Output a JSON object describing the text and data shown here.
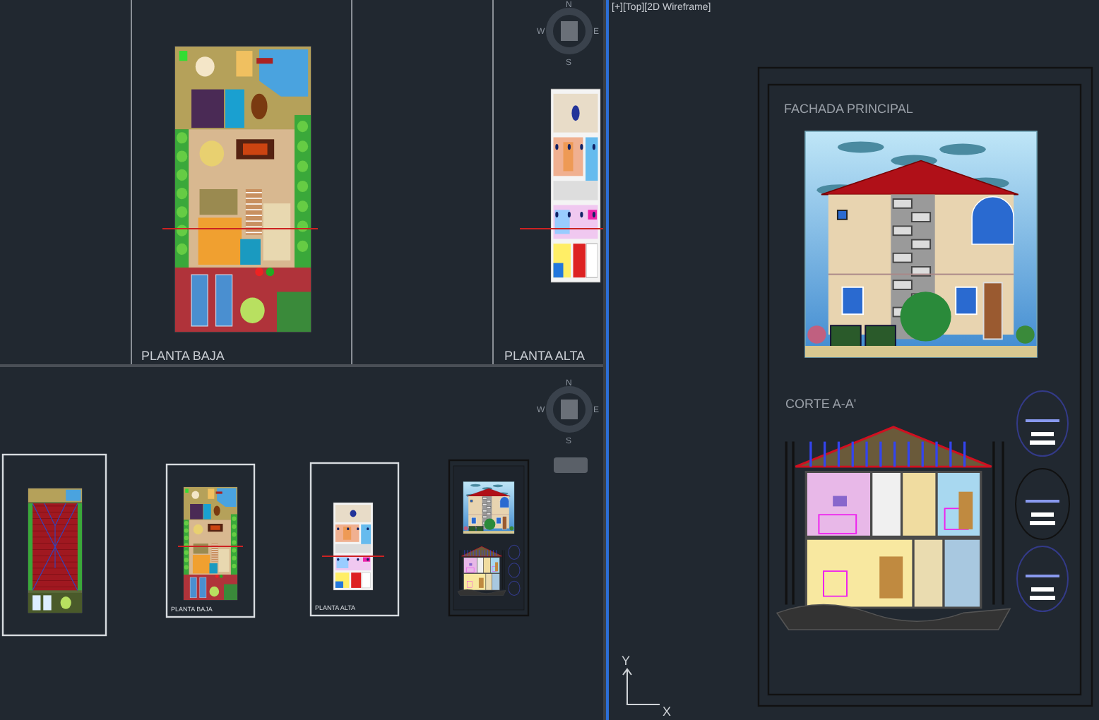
{
  "viewports": [
    {
      "kind": "plans",
      "active": false,
      "labels": [
        "PLANTA BAJA",
        "PLANTA ALTA"
      ],
      "compass": {
        "north": "N",
        "south": "S",
        "east": "E",
        "west": "W"
      }
    },
    {
      "kind": "sheets",
      "active": false,
      "sheets": [
        {
          "kind": "roof"
        },
        {
          "kind": "ground",
          "label": "PLANTA BAJA"
        },
        {
          "kind": "upper",
          "label": "PLANTA ALTA"
        },
        {
          "kind": "elevation"
        }
      ],
      "compass": {
        "north": "N",
        "south": "S",
        "east": "E",
        "west": "W"
      }
    },
    {
      "kind": "layout",
      "active": true,
      "title": "[+][Top][2D Wireframe]",
      "headings": [
        "FACHADA PRINCIPAL",
        "CORTE A-A'"
      ],
      "axes": {
        "y": "Y",
        "x": "X"
      }
    }
  ]
}
